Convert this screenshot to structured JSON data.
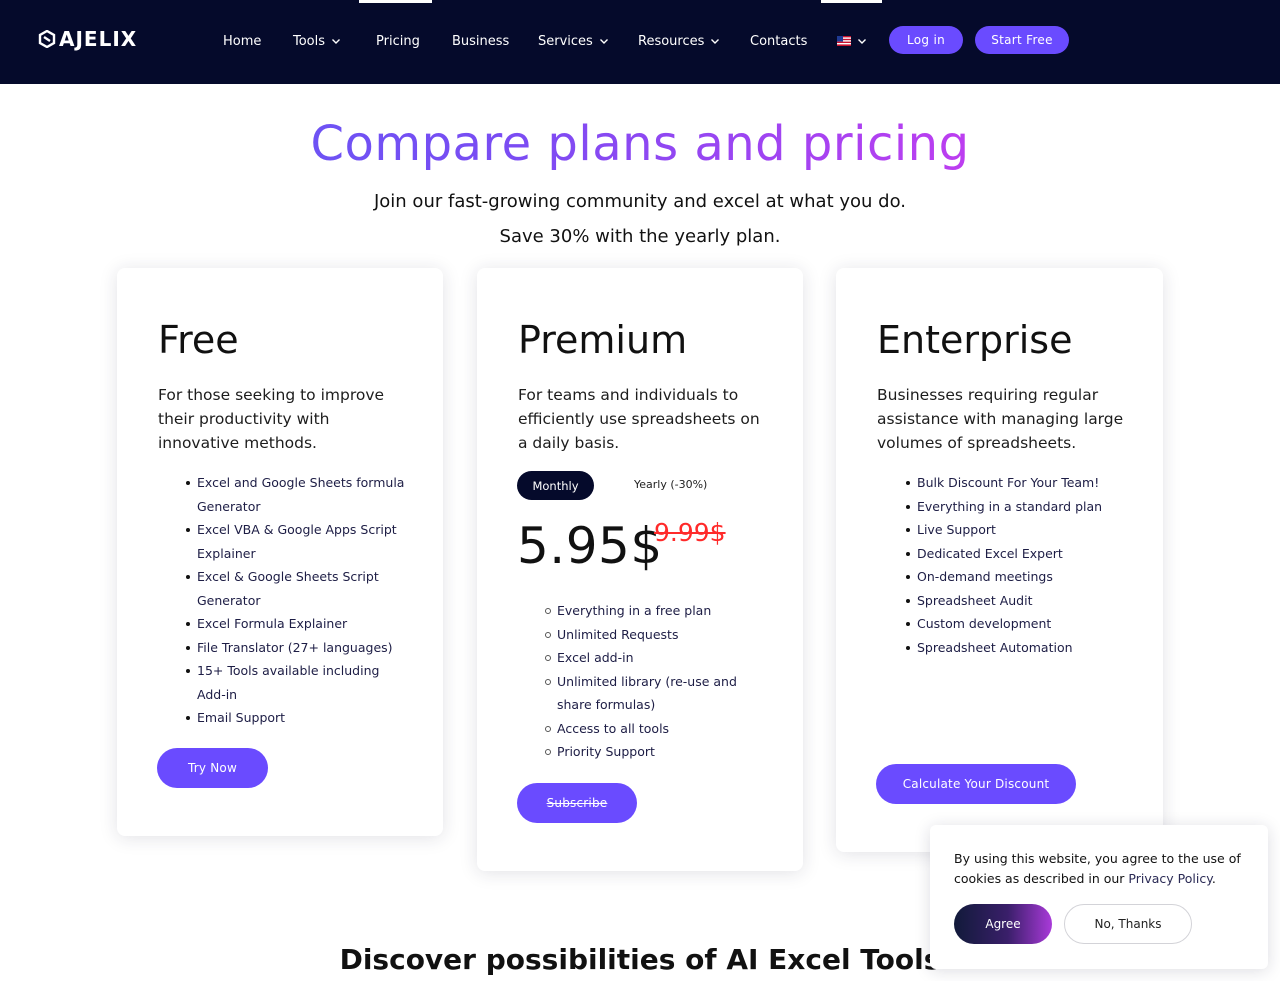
{
  "nav": {
    "logo_text": "AJELIX",
    "items": [
      {
        "label": "Home",
        "has_dropdown": false
      },
      {
        "label": "Tools",
        "has_dropdown": true
      },
      {
        "label": "Pricing",
        "has_dropdown": false
      },
      {
        "label": "Business",
        "has_dropdown": false
      },
      {
        "label": "Services",
        "has_dropdown": true
      },
      {
        "label": "Resources",
        "has_dropdown": true
      },
      {
        "label": "Contacts",
        "has_dropdown": false
      }
    ],
    "language_icon": "us-flag-icon",
    "login_label": "Log in",
    "start_label": "Start Free"
  },
  "hero": {
    "title": "Compare plans and pricing",
    "subtitle": "Join our fast-growing community and excel at what you do.",
    "save_note": "Save 30% with the yearly plan."
  },
  "plans": {
    "free": {
      "title": "Free",
      "description": "For those seeking to improve their productivity with innovative methods.",
      "features": [
        "Excel and Google Sheets formula Generator",
        "Excel VBA & Google Apps Script Explainer",
        "Excel & Google Sheets Script Generator",
        "Excel Formula Explainer",
        "File Translator (27+ languages)",
        "15+ Tools available including Add-in",
        "Email Support"
      ],
      "button": "Try Now"
    },
    "premium": {
      "title": "Premium",
      "description": "For teams and individuals to efficiently use spreadsheets on a daily basis.",
      "toggle_monthly": "Monthly",
      "toggle_yearly": "Yearly (-30%)",
      "price": "5.95$",
      "old_price": "9.99$",
      "features": [
        "Everything in a free plan",
        "Unlimited Requests",
        "Excel add-in",
        "Unlimited library (re-use and share formulas)",
        "Access to all tools",
        "Priority Support"
      ],
      "button": "Subscribe"
    },
    "enterprise": {
      "title": "Enterprise",
      "description": "Businesses requiring regular assistance with managing large volumes of spreadsheets.",
      "features": [
        "Bulk Discount For Your Team!",
        "Everything in a standard plan",
        "Live Support",
        "Dedicated Excel Expert",
        "On-demand meetings",
        "Spreadsheet Audit",
        "Custom development",
        "Spreadsheet Automation"
      ],
      "button": "Calculate Your Discount"
    }
  },
  "discover_heading": "Discover possibilities of AI Excel Tools",
  "cookie": {
    "text": "By using this website, you agree to the use of cookies as described in our",
    "link": "Privacy Policy",
    "period": ".",
    "agree": "Agree",
    "decline": "No, Thanks"
  },
  "colors": {
    "nav_bg": "#050a2b",
    "accent": "#6a4bff",
    "old_price": "#ff2a2a",
    "title_gradient": [
      "#5b5cf5",
      "#d23ae9"
    ]
  }
}
